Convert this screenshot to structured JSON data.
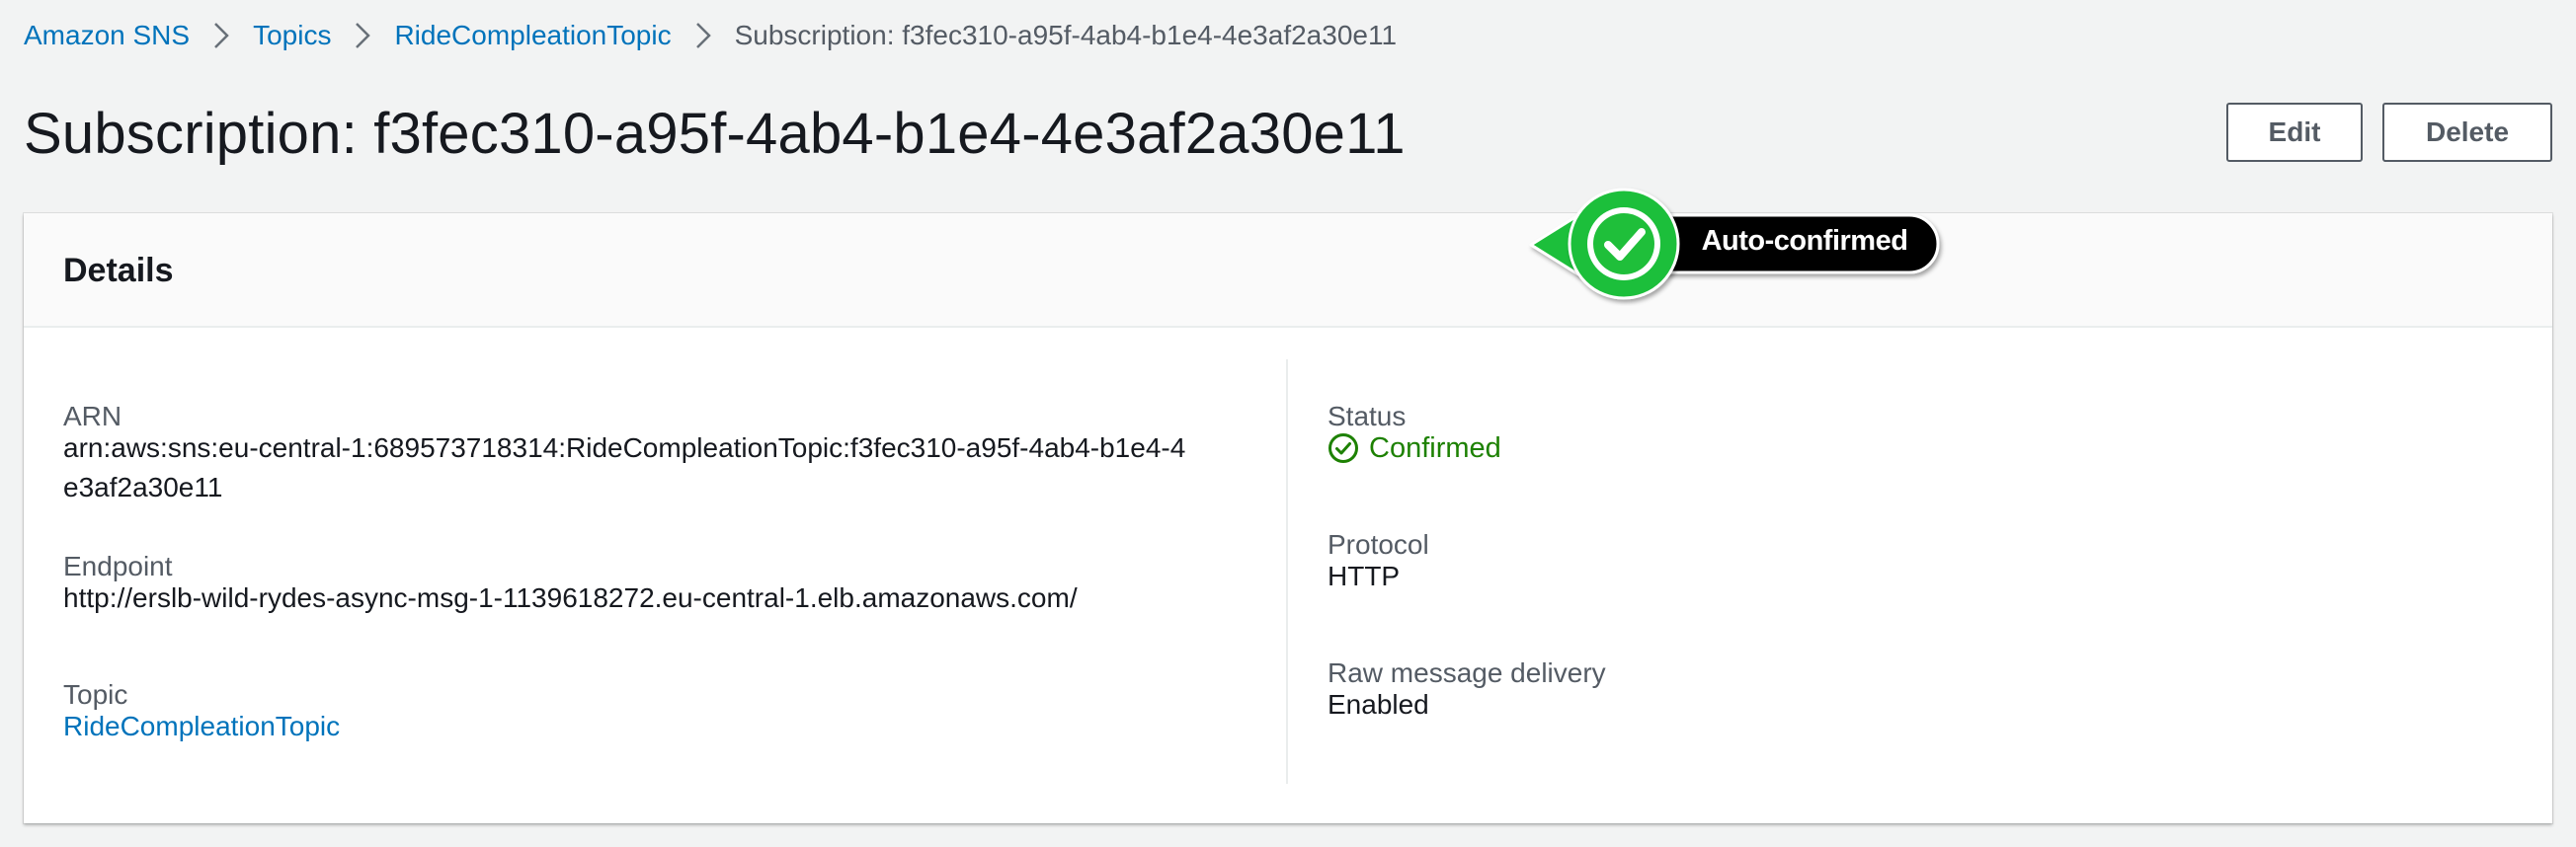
{
  "breadcrumb": {
    "items": [
      {
        "label": "Amazon SNS"
      },
      {
        "label": "Topics"
      },
      {
        "label": "RideCompleationTopic"
      }
    ],
    "current": "Subscription: f3fec310-a95f-4ab4-b1e4-4e3af2a30e11"
  },
  "page": {
    "title": "Subscription: f3fec310-a95f-4ab4-b1e4-4e3af2a30e11",
    "edit_label": "Edit",
    "delete_label": "Delete"
  },
  "details": {
    "title": "Details",
    "arn_label": "ARN",
    "arn_value": "arn:aws:sns:eu-central-1:689573718314:RideCompleationTopic:f3fec310-a95f-4ab4-b1e4-4e3af2a30e11",
    "endpoint_label": "Endpoint",
    "endpoint_value": "http://erslb-wild-rydes-async-msg-1-1139618272.eu-central-1.elb.amazonaws.com/",
    "topic_label": "Topic",
    "topic_value": "RideCompleationTopic",
    "status_label": "Status",
    "status_value": "Confirmed",
    "status_icon": "check-circle-icon",
    "protocol_label": "Protocol",
    "protocol_value": "HTTP",
    "raw_label": "Raw message delivery",
    "raw_value": "Enabled"
  },
  "annotation": {
    "label": "Auto-confirmed",
    "icon": "checkmark-badge-icon"
  },
  "colors": {
    "link": "#0073bb",
    "success": "#1d8102",
    "annotation_green": "#1fbf3a",
    "background": "#f2f3f3"
  }
}
